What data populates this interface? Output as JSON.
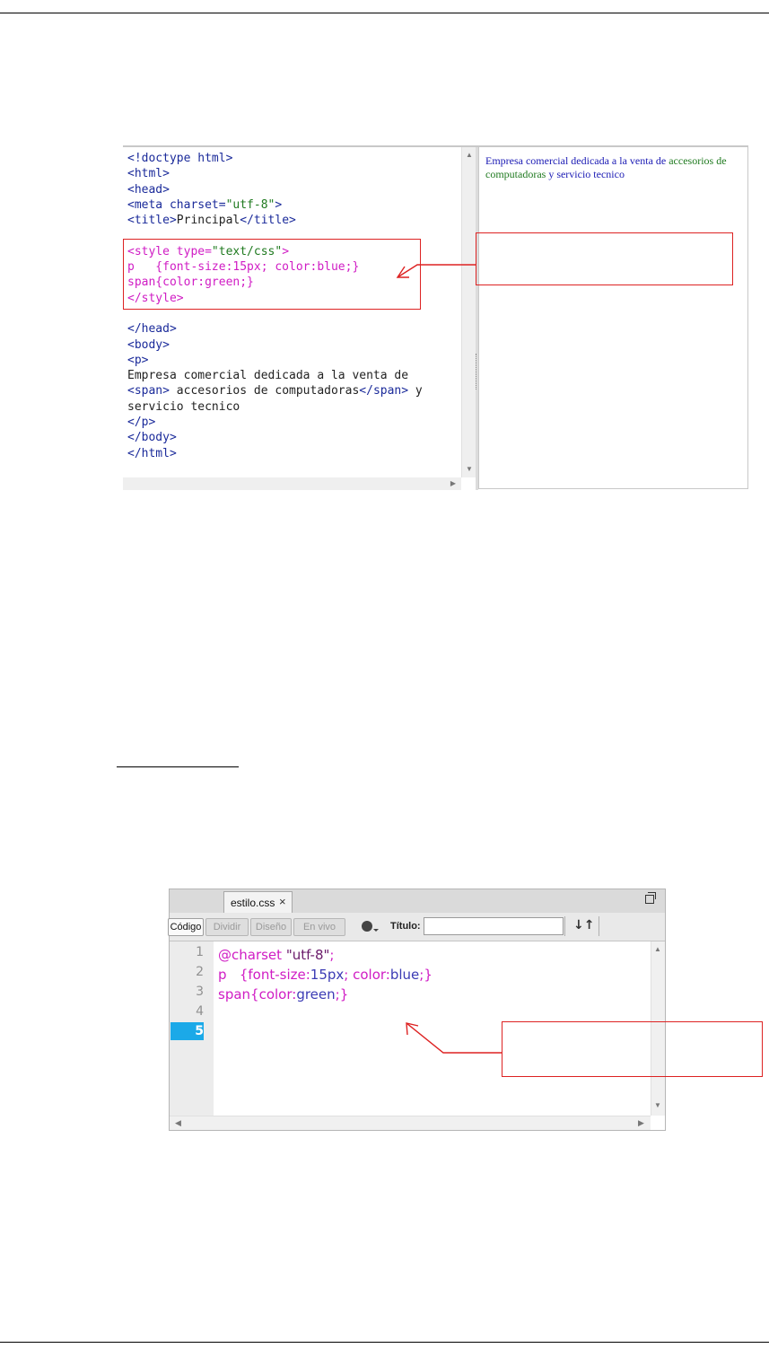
{
  "figure1": {
    "code_lines": {
      "l1": "<!doctype html>",
      "l2": "<html>",
      "l3": "<head>",
      "l4_tag_open": "<meta charset=",
      "l4_value": "\"utf-8\"",
      "l4_tag_close": ">",
      "l5_open": "<title>",
      "l5_text": "Principal",
      "l5_close": "</title>",
      "l7_open": "<style type=",
      "l7_value": "\"text/css\"",
      "l7_close": ">",
      "l8": "p   {font-size:15px; color:blue;}",
      "l9": "span{color:green;}",
      "l10": "</style>",
      "l12": "</head>",
      "l13": "<body>",
      "l14": "<p>",
      "l15": "Empresa comercial dedicada a la venta de",
      "l16_open": "<span>",
      "l16_text": " accesorios de computadoras",
      "l16_close": "</span>",
      "l16_tail": " y",
      "l17": "servicio tecnico",
      "l18": "</p>",
      "l19": "</body>",
      "l20": "</html>"
    },
    "preview": {
      "part1": "Empresa comercial dedicada a la venta de ",
      "part2": "accesorios de computadoras",
      "part3": " y servicio tecnico"
    }
  },
  "figure2": {
    "tab_label": "estilo.css",
    "tab_close": "×",
    "toolbar": {
      "code": "Código",
      "split": "Dividir",
      "design": "Diseño",
      "live": "En vivo",
      "title_label": "Título:",
      "title_value": "",
      "sort_glyph": "↓↑"
    },
    "line_numbers": [
      "1",
      "2",
      "3",
      "4",
      "5"
    ],
    "code_lines": {
      "l1_kw": "@charset ",
      "l1_str": "\"utf-8\"",
      "l1_end": ";",
      "l2_sel": "p   {font-size:",
      "l2_v1": "15px",
      "l2_mid": "; color:",
      "l2_v2": "blue",
      "l2_end": ";}",
      "l3_sel": "span{color:",
      "l3_v": "green",
      "l3_end": ";}"
    }
  },
  "colors": {
    "annotation_red": "#dd2222",
    "css_magenta": "#d01cc4",
    "html_tag_blue": "#1a2a9a",
    "current_line": "#1ba9e8"
  },
  "icons": [
    "globe-icon",
    "sort-icon",
    "restore-window-icon",
    "close-icon",
    "scroll-arrow-icon"
  ]
}
